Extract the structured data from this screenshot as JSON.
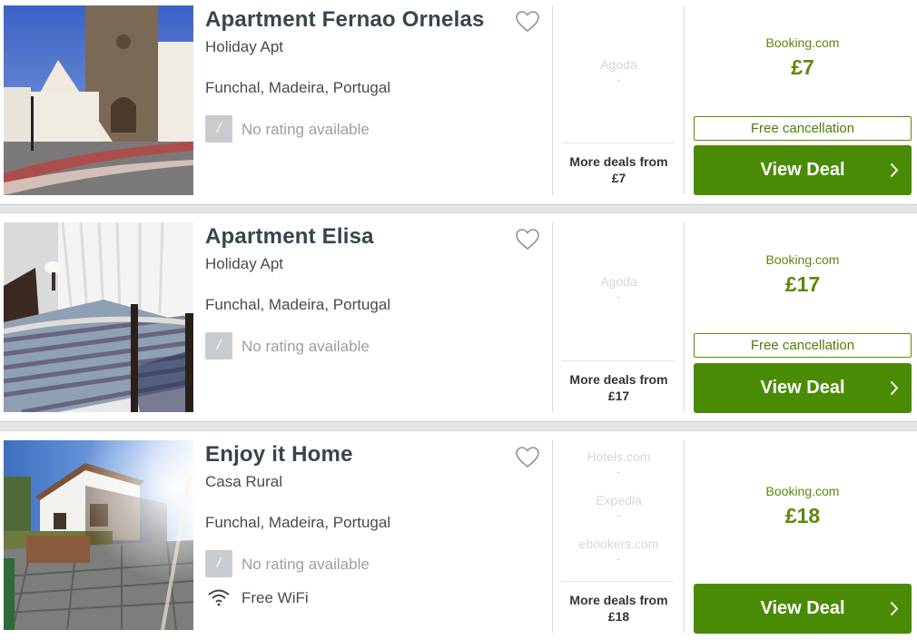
{
  "listings": [
    {
      "title": "Apartment Fernao Ornelas",
      "type": "Holiday Apt",
      "location": "Funchal, Madeira, Portugal",
      "rating_letter": "/",
      "rating_text": "No rating available",
      "partners": [
        {
          "name": "Agoda",
          "price": "-"
        }
      ],
      "more_deals": "More deals from",
      "more_deals_price": "£7",
      "provider": "Booking.com",
      "price": "£7",
      "free_cancellation": "Free cancellation",
      "view_deal": "View Deal"
    },
    {
      "title": "Apartment Elisa",
      "type": "Holiday Apt",
      "location": "Funchal, Madeira, Portugal",
      "rating_letter": "/",
      "rating_text": "No rating available",
      "partners": [
        {
          "name": "Agoda",
          "price": "-"
        }
      ],
      "more_deals": "More deals from",
      "more_deals_price": "£17",
      "provider": "Booking.com",
      "price": "£17",
      "free_cancellation": "Free cancellation",
      "view_deal": "View Deal"
    },
    {
      "title": "Enjoy it Home",
      "type": "Casa Rural",
      "location": "Funchal, Madeira, Portugal",
      "rating_letter": "/",
      "rating_text": "No rating available",
      "amenity": "Free WiFi",
      "partners": [
        {
          "name": "Hotels.com",
          "price": "-"
        },
        {
          "name": "Expedia",
          "price": "-"
        },
        {
          "name": "ebookers.com",
          "price": "-"
        }
      ],
      "more_deals": "More deals from",
      "more_deals_price": "£18",
      "provider": "Booking.com",
      "price": "£18",
      "view_deal": "View Deal"
    }
  ],
  "colors": {
    "accent_green": "#4a8b06",
    "price_green": "#5a8a0a",
    "title": "#37454d"
  },
  "icons": [
    "heart-icon",
    "chevron-right-icon",
    "wifi-icon"
  ]
}
